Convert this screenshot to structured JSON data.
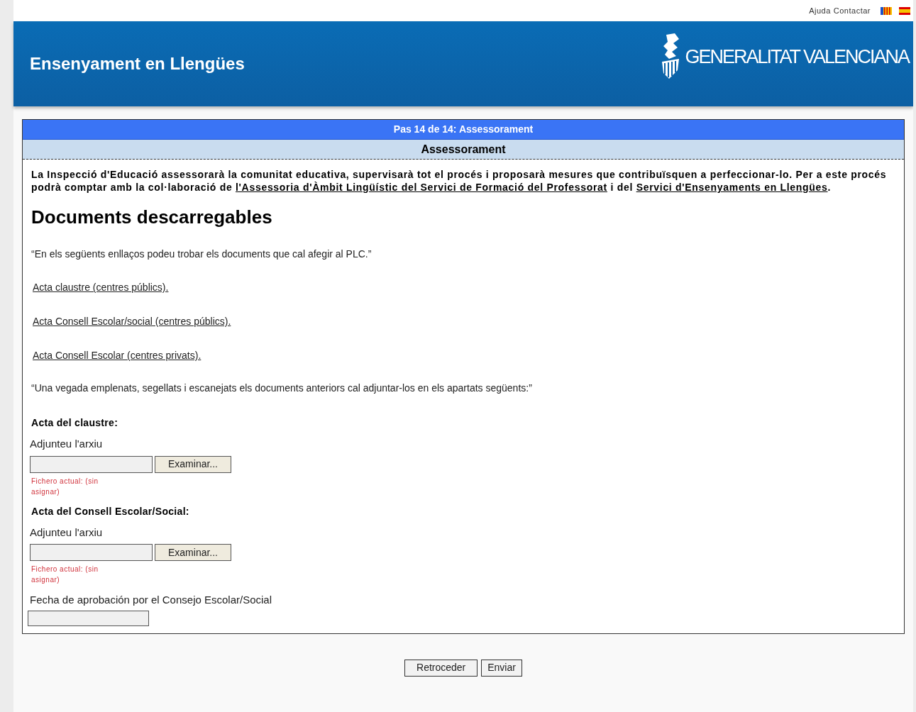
{
  "top_links": [
    "Ajuda",
    "Contactar"
  ],
  "languages": [
    {
      "kind": "valencian"
    },
    {
      "kind": "spanish"
    }
  ],
  "banner": {
    "title": "Ensenyament en Llengües",
    "logo_text": "GENERALITAT VALENCIANA"
  },
  "step_title": "Pas 14 de 14: Assessorament",
  "section_title": "Assessorament",
  "intro": [
    {
      "kind": "text",
      "text": "La Inspecció d'Educació assessorarà la comunitat educativa, supervisarà tot el procés i proposarà mesures que contribuïsquen a perfeccionar-lo. Per a este procés podrà comptar amb la col·laboració de "
    },
    {
      "kind": "link",
      "text": "l'Assessoria d'Àmbit Lingüístic del Servici de Formació del Professorat"
    },
    {
      "kind": "text",
      "text": " i del "
    },
    {
      "kind": "link",
      "text": "Servici d'Ensenyaments en Llengües"
    },
    {
      "kind": "text",
      "text": "."
    }
  ],
  "documents_heading": "Documents descarregables",
  "documents_note": "“En els següents enllaços podeu trobar els documents que cal afegir al PLC.”",
  "document_links": [
    "Acta claustre (centres públics).",
    "Acta Consell Escolar/social (centres públics).",
    "Acta Consell Escolar (centres privats)."
  ],
  "upload_note": "“Una vegada emplenats, segellats i escanejats els documents anteriors cal adjuntar-los en els apartats següents:”",
  "uploads": [
    {
      "heading": "Acta del claustre:",
      "label": "Adjunteu l'arxiu",
      "button": "Examinar...",
      "current_file": "Fichero actual: (sin asignar)"
    },
    {
      "heading": "Acta del Consell Escolar/Social:",
      "label": "Adjunteu l'arxiu",
      "button": "Examinar...",
      "current_file": "Fichero actual: (sin asignar)"
    }
  ],
  "date_field": {
    "label": "Fecha de aprobación por el Consejo Escolar/Social"
  },
  "buttons": [
    "Retroceder",
    "Enviar"
  ]
}
